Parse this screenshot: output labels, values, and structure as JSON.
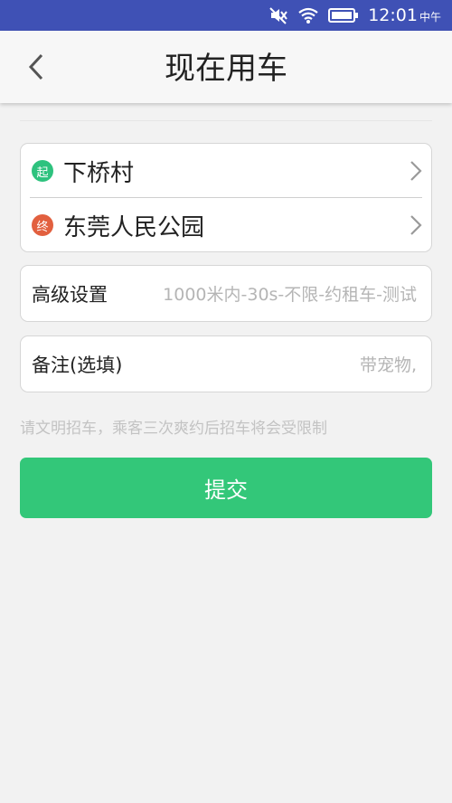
{
  "status_bar": {
    "time": "12:01",
    "ampm": "中午",
    "icons": [
      "mute-icon",
      "wifi-icon",
      "battery-icon"
    ]
  },
  "header": {
    "title": "现在用车",
    "back_icon": "chevron-left-icon"
  },
  "route": {
    "start_badge": "起",
    "start_label": "下桥村",
    "end_badge": "终",
    "end_label": "东莞人民公园"
  },
  "advanced": {
    "label": "高级设置",
    "value": "1000米内-30s-不限-约租车-测试"
  },
  "note": {
    "label": "备注(选填)",
    "placeholder": "带宠物,"
  },
  "hint": "请文明招车，乘客三次爽约后招车将会受限制",
  "submit_label": "提交",
  "colors": {
    "status_bar": "#3f51b5",
    "start_badge": "#2ec27e",
    "end_badge": "#e2603f",
    "submit": "#33c779"
  }
}
